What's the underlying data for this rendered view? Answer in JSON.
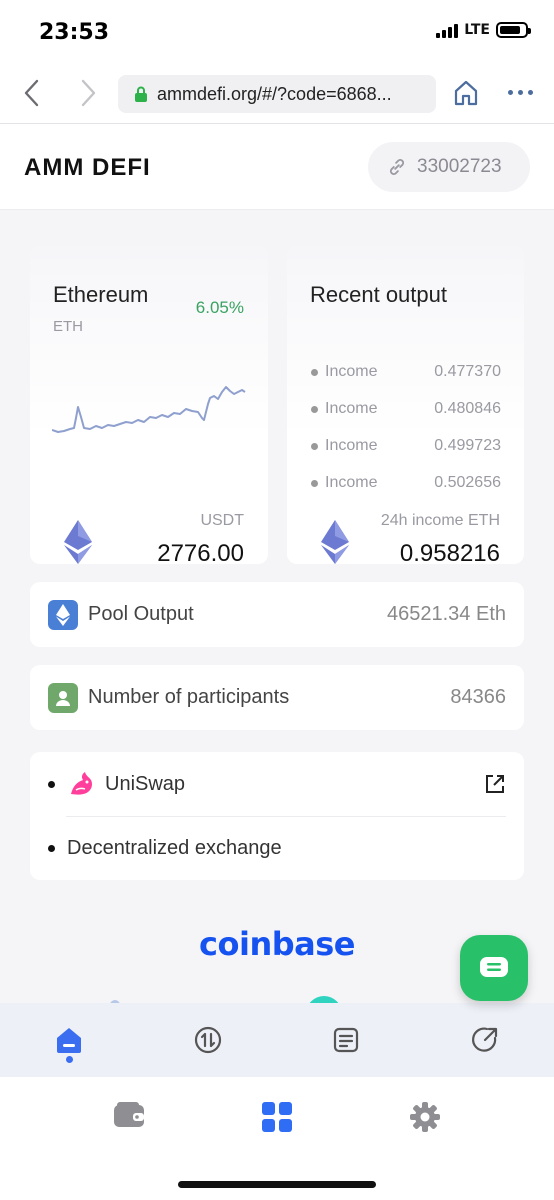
{
  "status_bar": {
    "time": "23:53",
    "network": "LTE"
  },
  "browser": {
    "url": "ammdefi.org/#/?code=6868..."
  },
  "header": {
    "title": "AMM DEFI",
    "invite_code": "33002723"
  },
  "eth_card": {
    "title": "Ethereum",
    "symbol": "ETH",
    "change": "6.05%",
    "price_label": "USDT",
    "price": "2776.00",
    "change_color": "#3aa361"
  },
  "recent_card": {
    "title": "Recent output",
    "items": [
      {
        "label": "Income",
        "value": "0.477370"
      },
      {
        "label": "Income",
        "value": "0.480846"
      },
      {
        "label": "Income",
        "value": "0.499723"
      },
      {
        "label": "Income",
        "value": "0.502656"
      }
    ],
    "total_label": "24h income ETH",
    "total": "0.958216"
  },
  "pool": {
    "label": "Pool Output",
    "value": "46521.34 Eth",
    "icon": "ethereum-icon"
  },
  "participants": {
    "label": "Number of participants",
    "value": "84366",
    "icon": "user-icon"
  },
  "uniswap": {
    "name": "UniSwap",
    "description": "Decentralized exchange",
    "icon": "unicorn-icon"
  },
  "partners": {
    "coinbase": "coinbase"
  },
  "tabs": [
    {
      "name": "home",
      "icon": "home-icon",
      "active": true
    },
    {
      "name": "swap",
      "icon": "swap-icon",
      "active": false
    },
    {
      "name": "records",
      "icon": "document-icon",
      "active": false
    },
    {
      "name": "share",
      "icon": "share-icon",
      "active": false
    }
  ],
  "browser_toolbar": [
    {
      "name": "wallet",
      "icon": "wallet-icon"
    },
    {
      "name": "apps",
      "icon": "grid-icon"
    },
    {
      "name": "settings",
      "icon": "gear-icon"
    }
  ],
  "colors": {
    "accent": "#3a6df0",
    "positive": "#3aa361",
    "coinbase": "#1652f0",
    "chat": "#29c06a"
  }
}
